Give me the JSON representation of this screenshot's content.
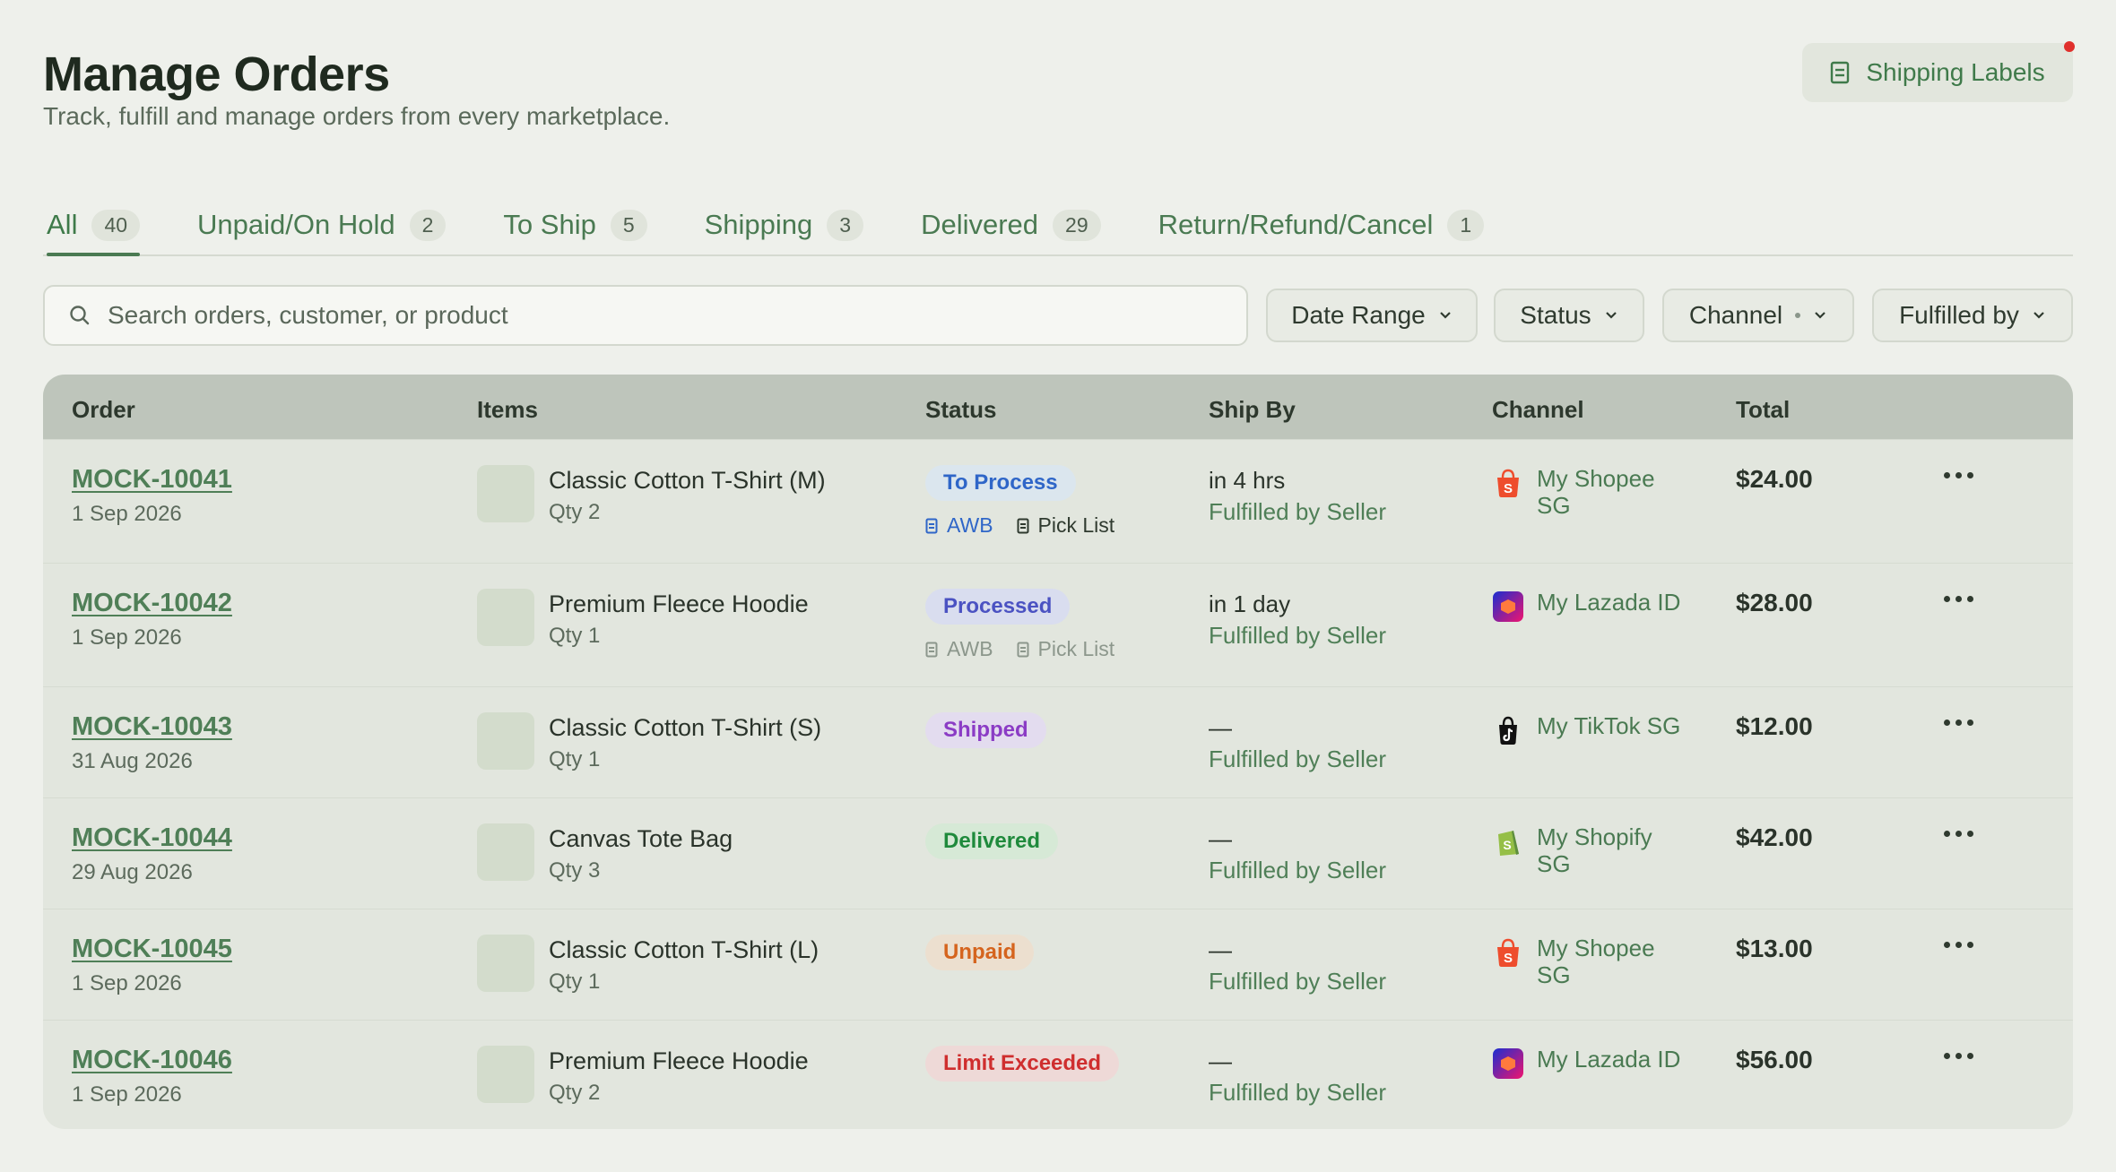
{
  "header": {
    "title": "Manage Orders",
    "subtitle": "Track, fulfill and manage orders from every marketplace.",
    "shipping_labels_button": "Shipping Labels"
  },
  "tabs": [
    {
      "label": "All",
      "count": "40",
      "active": true
    },
    {
      "label": "Unpaid/On Hold",
      "count": "2"
    },
    {
      "label": "To Ship",
      "count": "5"
    },
    {
      "label": "Shipping",
      "count": "3"
    },
    {
      "label": "Delivered",
      "count": "29"
    },
    {
      "label": "Return/Refund/Cancel",
      "count": "1"
    }
  ],
  "search": {
    "placeholder": "Search orders, customer, or product"
  },
  "filters": {
    "date_range": "Date Range",
    "status": "Status",
    "channel": "Channel",
    "fulfilled_by": "Fulfilled by"
  },
  "table": {
    "headers": {
      "order": "Order",
      "items": "Items",
      "status": "Status",
      "ship_by": "Ship By",
      "channel": "Channel",
      "total": "Total"
    },
    "rows": [
      {
        "order_id": "MOCK-10041",
        "date": "1 Sep 2026",
        "item": "Classic Cotton T-Shirt (M)",
        "qty": "Qty 2",
        "status": "To Process",
        "awb": "AWB",
        "pick_list": "Pick List",
        "ship_time": "in 4 hrs",
        "fulfilled": "Fulfilled by Seller",
        "channel": "My Shopee SG",
        "channel_icon": "shopee-icon",
        "total": "$24.00"
      },
      {
        "order_id": "MOCK-10042",
        "date": "1 Sep 2026",
        "item": "Premium Fleece Hoodie",
        "qty": "Qty 1",
        "status": "Processed",
        "awb": "AWB",
        "pick_list": "Pick List",
        "ship_time": "in 1 day",
        "fulfilled": "Fulfilled by Seller",
        "channel": "My Lazada ID",
        "channel_icon": "lazada-icon",
        "total": "$28.00"
      },
      {
        "order_id": "MOCK-10043",
        "date": "31 Aug 2026",
        "item": "Classic Cotton T-Shirt (S)",
        "qty": "Qty 1",
        "status": "Shipped",
        "ship_time": "—",
        "fulfilled": "Fulfilled by Seller",
        "channel": "My TikTok SG",
        "channel_icon": "tiktok-icon",
        "total": "$12.00"
      },
      {
        "order_id": "MOCK-10044",
        "date": "29 Aug 2026",
        "item": "Canvas Tote Bag",
        "qty": "Qty 3",
        "status": "Delivered",
        "ship_time": "—",
        "fulfilled": "Fulfilled by Seller",
        "channel": "My Shopify SG",
        "channel_icon": "shopify-icon",
        "total": "$42.00"
      },
      {
        "order_id": "MOCK-10045",
        "date": "1 Sep 2026",
        "item": "Classic Cotton T-Shirt (L)",
        "qty": "Qty 1",
        "status": "Unpaid",
        "ship_time": "—",
        "fulfilled": "Fulfilled by Seller",
        "channel": "My Shopee SG",
        "channel_icon": "shopee-icon",
        "total": "$13.00"
      },
      {
        "order_id": "MOCK-10046",
        "date": "1 Sep 2026",
        "item": "Premium Fleece Hoodie",
        "qty": "Qty 2",
        "status": "Limit Exceeded",
        "ship_time": "—",
        "fulfilled": "Fulfilled by Seller",
        "channel": "My Lazada ID",
        "channel_icon": "lazada-icon",
        "total": "$56.00"
      }
    ]
  },
  "colors": {
    "accent": "#4a7a52",
    "background": "#eef0eb",
    "notification": "#e0302c"
  }
}
